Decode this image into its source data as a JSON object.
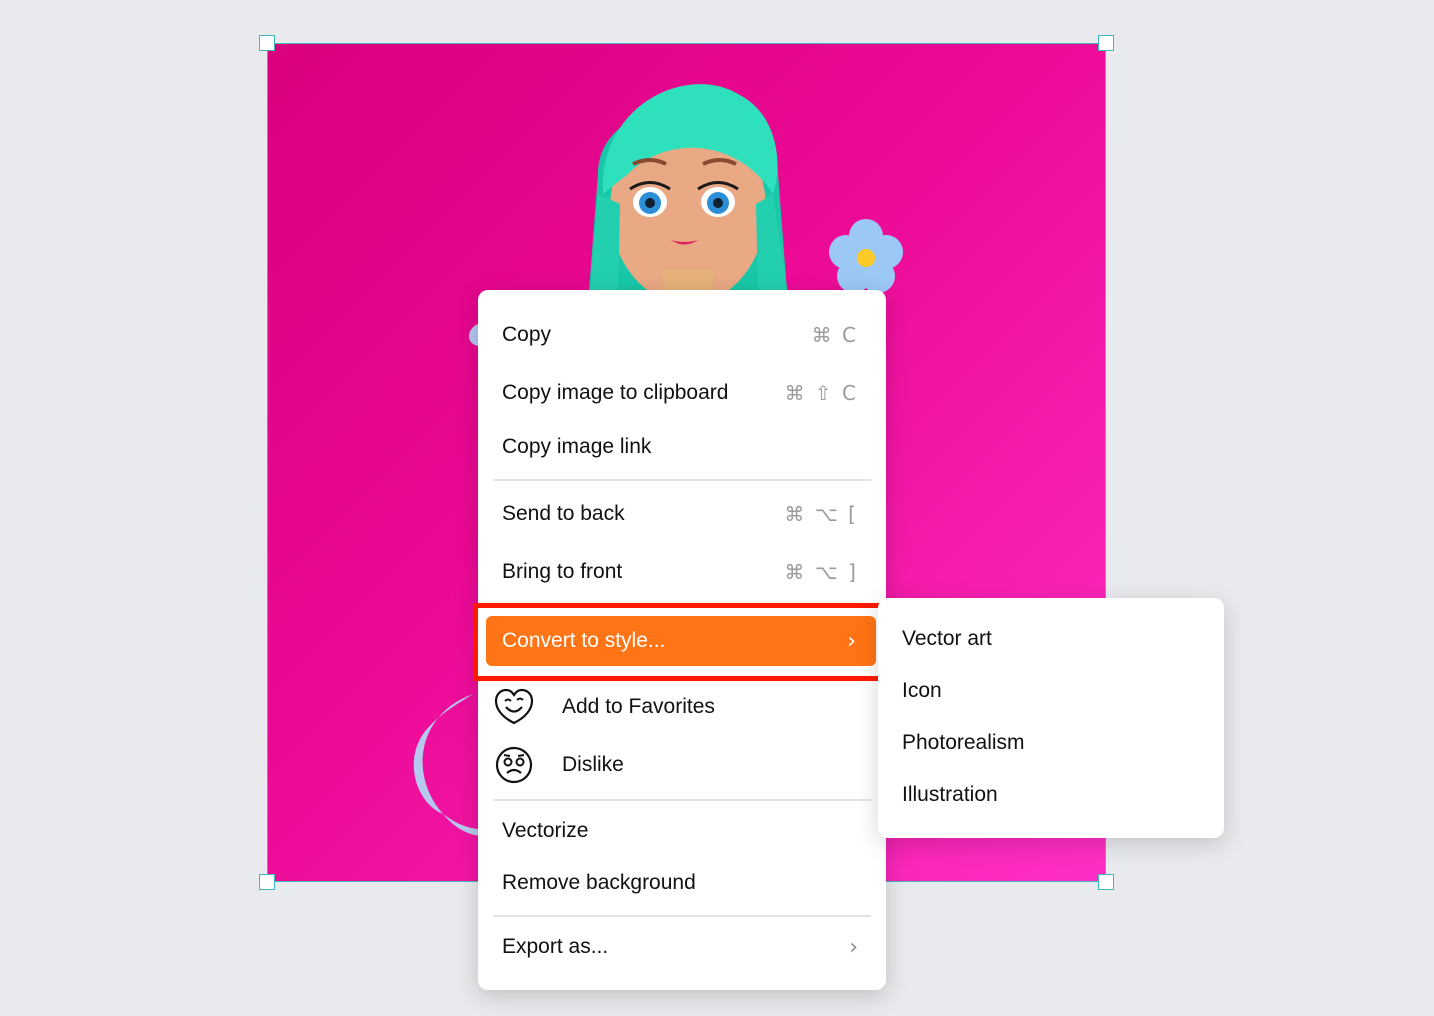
{
  "context_menu": {
    "copy": {
      "label": "Copy",
      "shortcut": "⌘ C"
    },
    "copy_image": {
      "label": "Copy image to clipboard",
      "shortcut": "⌘ ⇧ C"
    },
    "copy_link": {
      "label": "Copy image link"
    },
    "send_back": {
      "label": "Send to back",
      "shortcut": "⌘ ⌥ ["
    },
    "bring_front": {
      "label": "Bring to front",
      "shortcut": "⌘ ⌥ ]"
    },
    "convert_style": {
      "label": "Convert to style..."
    },
    "favorites": {
      "label": "Add to Favorites",
      "icon": "smiley-heart-icon"
    },
    "dislike": {
      "label": "Dislike",
      "icon": "sad-face-icon"
    },
    "vectorize": {
      "label": "Vectorize"
    },
    "remove_bg": {
      "label": "Remove background"
    },
    "export": {
      "label": "Export as..."
    }
  },
  "submenu": {
    "items": [
      "Vector art",
      "Icon",
      "Photorealism",
      "Illustration"
    ]
  },
  "colors": {
    "accent": "#ff7414",
    "highlight_outline": "#ff1a00",
    "selection": "#3fb8bd",
    "image_bg": "#ec0a96"
  }
}
